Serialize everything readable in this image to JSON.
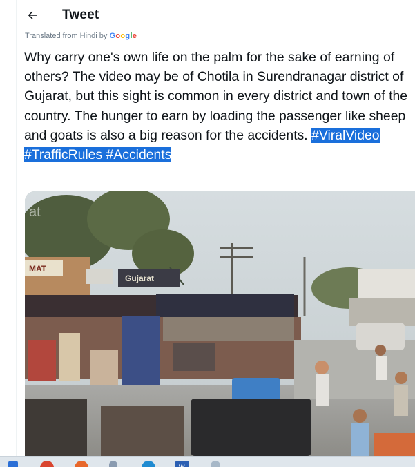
{
  "header": {
    "back_icon": "arrow-left-icon",
    "title": "Tweet"
  },
  "translation": {
    "prefix": "Translated from Hindi by",
    "brand": "Google"
  },
  "tweet": {
    "body": "Why carry one's own life on the palm for the sake of earning of others? The video may be of Chotila in Surendranagar district of Gujarat, but this sight is common in every district and town of the country. The hunger to earn by loading the passenger like sheep and goats is also a big reason for the accidents.",
    "hashtags": "#ViralVideo #TrafficRules #Accidents"
  },
  "media": {
    "watermark": "at",
    "shop_signs": [
      "MAT",
      "Gujarat"
    ]
  },
  "taskbar": {
    "icons": [
      "start-icon",
      "chrome-icon",
      "firefox-icon",
      "pen-icon",
      "edge-icon",
      "word-icon",
      "files-icon"
    ],
    "word_label": "W"
  },
  "colors": {
    "hashtag_highlight": "#1a6fdb",
    "text": "#0f1419",
    "secondary": "#6a7885"
  }
}
